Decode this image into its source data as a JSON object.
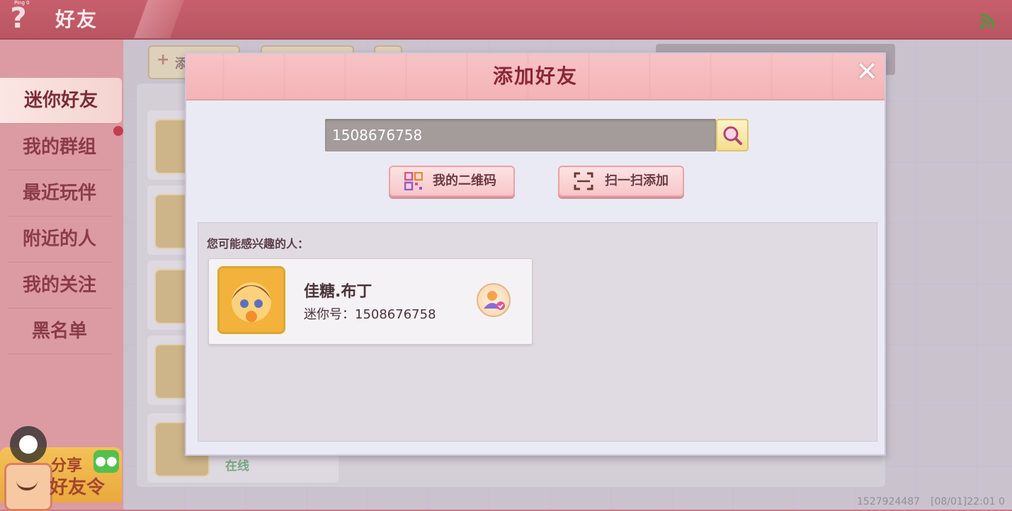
{
  "status": {
    "ping": "Ping 0"
  },
  "topbar": {
    "help_label": "?",
    "title": "好友"
  },
  "sidebar": {
    "items": [
      {
        "label": "迷你好友"
      },
      {
        "label": "我的群组"
      },
      {
        "label": "最近玩伴"
      },
      {
        "label": "附近的人"
      },
      {
        "label": "我的关注"
      },
      {
        "label": "黑名单"
      }
    ],
    "share": {
      "line1": "分享",
      "line2": "好友令"
    }
  },
  "background": {
    "online_text": "在线",
    "add_tab_fragment": "添"
  },
  "dialog": {
    "title": "添加好友",
    "search": {
      "value": "1508676758"
    },
    "qr_button": "我的二维码",
    "scan_button": "扫一扫添加",
    "suggest_title": "您可能感兴趣的人：",
    "suggestion": {
      "name": "佳糖.布丁",
      "id_text": "迷你号：1508676758"
    }
  },
  "footer": {
    "user_id": "1527924487",
    "timestamp": "[08/01]22:01 0"
  },
  "colors": {
    "accent": "#c85f6c",
    "dialog_header": "#f4b4b6",
    "title_text": "#8b2636"
  }
}
